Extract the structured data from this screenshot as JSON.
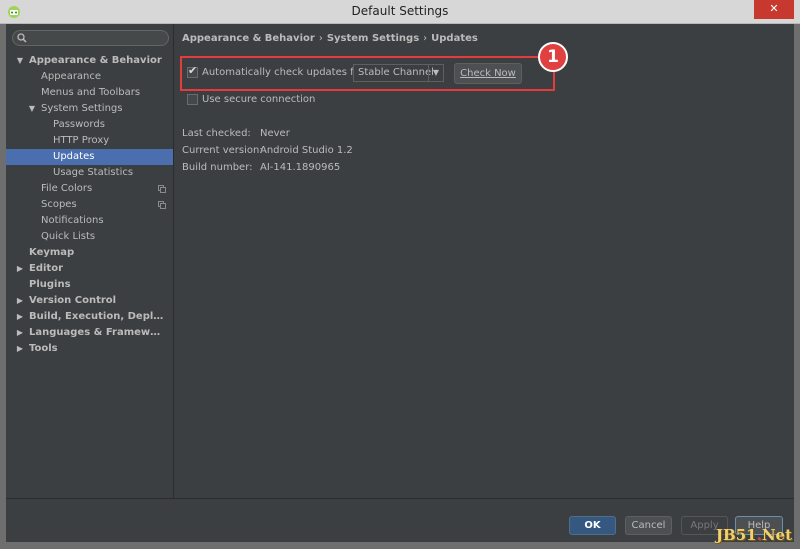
{
  "window": {
    "title": "Default Settings",
    "close_glyph": "✕",
    "app_icon": "android-studio-icon"
  },
  "search": {
    "icon": "search-icon",
    "placeholder": ""
  },
  "sidebar": {
    "items": [
      {
        "label": "Appearance & Behavior",
        "level": 0,
        "arrow": "▼",
        "bold": true
      },
      {
        "label": "Appearance",
        "level": 1,
        "arrow": "",
        "bold": false
      },
      {
        "label": "Menus and Toolbars",
        "level": 1,
        "arrow": "",
        "bold": false
      },
      {
        "label": "System Settings",
        "level": 1,
        "arrow": "▼",
        "bold": false
      },
      {
        "label": "Passwords",
        "level": 2,
        "arrow": "",
        "bold": false
      },
      {
        "label": "HTTP Proxy",
        "level": 2,
        "arrow": "",
        "bold": false
      },
      {
        "label": "Updates",
        "level": 2,
        "arrow": "",
        "bold": false,
        "selected": true
      },
      {
        "label": "Usage Statistics",
        "level": 2,
        "arrow": "",
        "bold": false
      },
      {
        "label": "File Colors",
        "level": 1,
        "arrow": "",
        "bold": false,
        "copy_icon": true
      },
      {
        "label": "Scopes",
        "level": 1,
        "arrow": "",
        "bold": false,
        "copy_icon": true
      },
      {
        "label": "Notifications",
        "level": 1,
        "arrow": "",
        "bold": false
      },
      {
        "label": "Quick Lists",
        "level": 1,
        "arrow": "",
        "bold": false
      },
      {
        "label": "Keymap",
        "level": 0,
        "arrow": "",
        "bold": true
      },
      {
        "label": "Editor",
        "level": 0,
        "arrow": "▶",
        "bold": true
      },
      {
        "label": "Plugins",
        "level": 0,
        "arrow": "",
        "bold": true
      },
      {
        "label": "Version Control",
        "level": 0,
        "arrow": "▶",
        "bold": true
      },
      {
        "label": "Build, Execution, Deployme...",
        "level": 0,
        "arrow": "▶",
        "bold": true
      },
      {
        "label": "Languages & Frameworks",
        "level": 0,
        "arrow": "▶",
        "bold": true
      },
      {
        "label": "Tools",
        "level": 0,
        "arrow": "▶",
        "bold": true
      }
    ]
  },
  "breadcrumb": {
    "parts": [
      "Appearance & Behavior",
      "System Settings",
      "Updates"
    ],
    "separator": "›"
  },
  "updates": {
    "auto_check_label": "Automatically check updates for",
    "auto_check_checked": true,
    "channel_value": "Stable Channel",
    "check_now_label": "Check Now",
    "secure_label": "Use secure connection",
    "secure_checked": false,
    "annotation_number": "1"
  },
  "info": {
    "last_checked_label": "Last checked:",
    "last_checked_value": "Never",
    "current_version_label": "Current version:",
    "current_version_value": "Android Studio 1.2",
    "build_number_label": "Build number:",
    "build_number_value": "AI-141.1890965"
  },
  "footer": {
    "ok_label": "OK",
    "cancel_label": "Cancel",
    "apply_label": "Apply",
    "help_label": "Help"
  },
  "watermark": {
    "text_a": "JB51",
    "text_dot": ".",
    "text_b": "Net"
  },
  "colors": {
    "background": "#3c3f41",
    "selection": "#4b6eaf",
    "highlight_red": "#e23c3c",
    "ok_button": "#365880"
  }
}
